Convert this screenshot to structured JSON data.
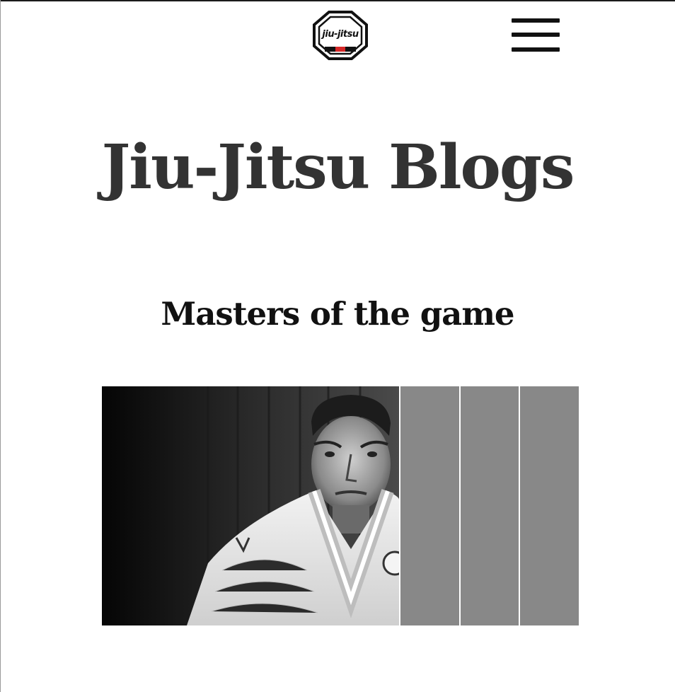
{
  "header": {
    "logo_text": "jiu-jitsu",
    "menu_icon": "hamburger-icon"
  },
  "main": {
    "page_title": "Jiu-Jitsu Blogs",
    "section_title": "Masters of the game"
  },
  "gallery": {
    "panels": [
      {
        "kind": "photo",
        "description_icon": "portrait-photo"
      },
      {
        "kind": "placeholder"
      },
      {
        "kind": "placeholder"
      },
      {
        "kind": "placeholder"
      }
    ]
  },
  "colors": {
    "title": "#333333",
    "section_title": "#111111",
    "placeholder_panel": "#888888",
    "logo_accent": "#d62828"
  }
}
